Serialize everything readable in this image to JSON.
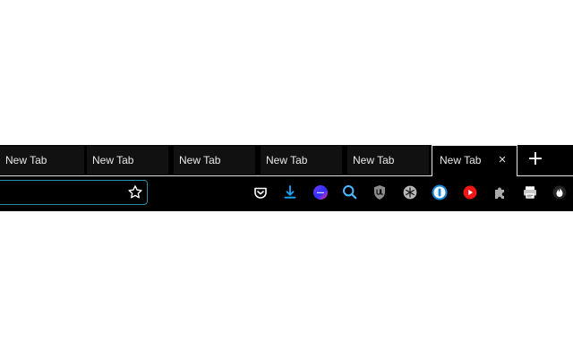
{
  "browser": {
    "tabs": [
      {
        "label": "New Tab"
      },
      {
        "label": "New Tab"
      },
      {
        "label": "New Tab"
      },
      {
        "label": "New Tab"
      },
      {
        "label": "New Tab"
      },
      {
        "label": "New Tab",
        "close_glyph": "×"
      }
    ],
    "new_tab_glyph": "+",
    "address_bar": {
      "value": "",
      "placeholder": ""
    }
  },
  "icons": {
    "bookmark": "star-icon",
    "pocket": "pocket-icon",
    "download": "download-icon",
    "colorful_extension": "circle-extension-icon",
    "search": "search-icon",
    "ublock": "ublock-origin-icon",
    "snowflake": "snowflake-extension-icon",
    "password": "password-manager-icon",
    "youtube": "youtube-icon",
    "puzzle": "extensions-puzzle-icon",
    "printer": "printer-icon",
    "fire": "fire-icon"
  },
  "colors": {
    "chrome_background": "#000000",
    "tab_background": "#111111",
    "active_tab_border": "#e6e6e6",
    "address_focus_border": "#2b8ea5",
    "accent_blue": "#1685d7",
    "youtube_red": "#ef1616"
  }
}
